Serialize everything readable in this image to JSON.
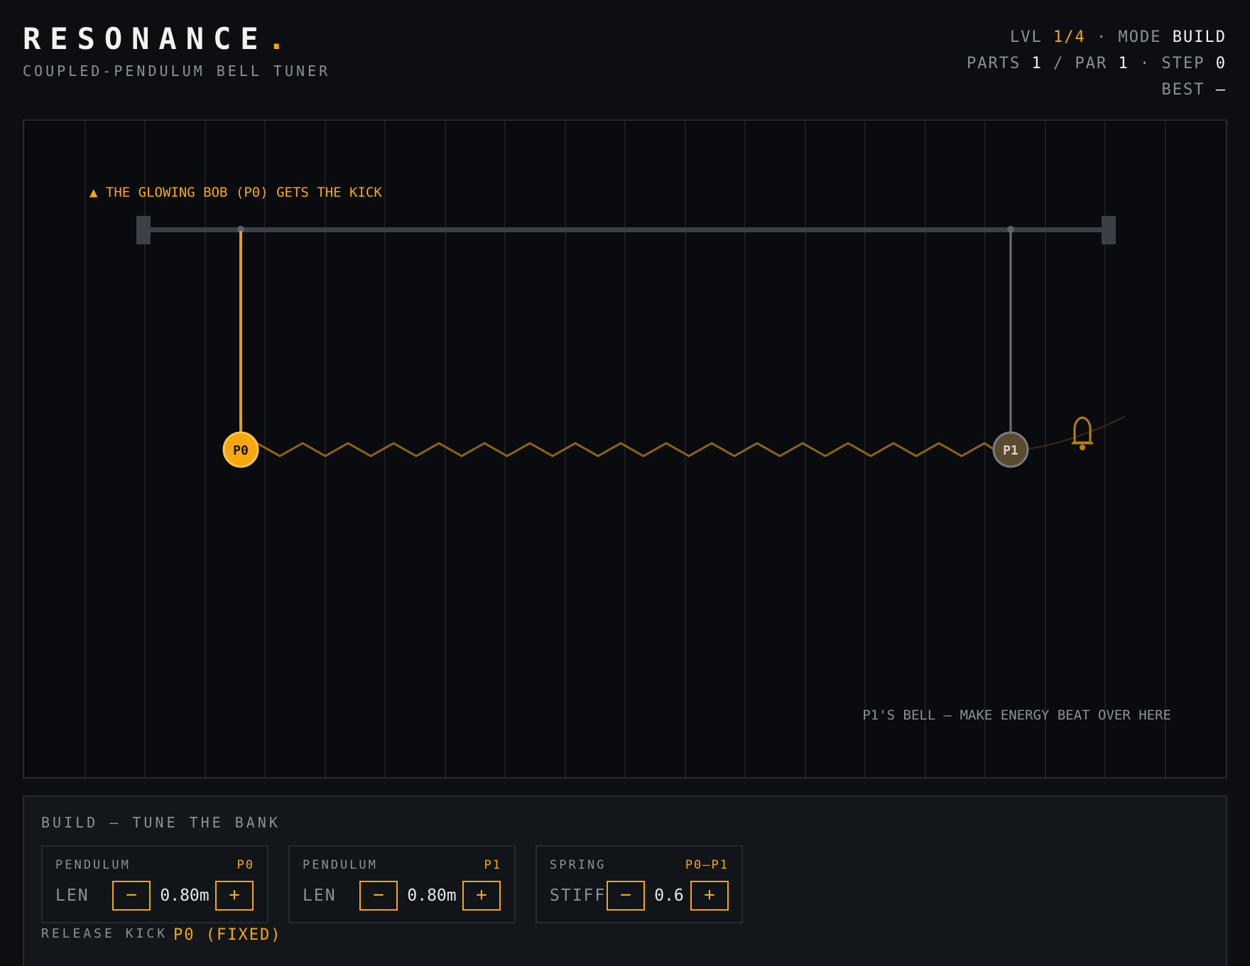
{
  "header": {
    "title": "RESONANCE",
    "title_dot": ".",
    "subtitle": "COUPLED-PENDULUM BELL TUNER"
  },
  "hud": {
    "lvl_label": "LVL",
    "lvl_value": "1/4",
    "sep": "·",
    "mode_label": "MODE",
    "mode_value": "BUILD",
    "parts_label": "PARTS",
    "parts_value": "1",
    "slash": "/",
    "par_label": "PAR",
    "par_value": "1",
    "step_label": "STEP",
    "step_value": "0",
    "best_label": "BEST",
    "best_value": "—"
  },
  "stage": {
    "hint_top": "▲ THE GLOWING BOB (P0) GETS THE KICK",
    "hint_bottom": "P1'S BELL — MAKE ENERGY BEAT OVER HERE",
    "pendulums": [
      {
        "id": "P0",
        "label": "P0",
        "active": true
      },
      {
        "id": "P1",
        "label": "P1",
        "active": false
      }
    ],
    "bell_icon": "bell-icon"
  },
  "build": {
    "title": "BUILD — TUNE THE BANK",
    "cards": [
      {
        "kind": "PENDULUM",
        "target": "P0",
        "param": "LEN",
        "value": "0.80m",
        "minus": "−",
        "plus": "+"
      },
      {
        "kind": "PENDULUM",
        "target": "P1",
        "param": "LEN",
        "value": "0.80m",
        "minus": "−",
        "plus": "+"
      },
      {
        "kind": "SPRING",
        "target": "P0–P1",
        "param": "STIFF",
        "value": "0.6",
        "minus": "−",
        "plus": "+"
      }
    ],
    "release_label": "RELEASE KICK",
    "release_value": "P0 (FIXED)"
  },
  "colors": {
    "accent": "#f5a80f",
    "background": "#0c0e12",
    "inactive_bob": "#5a4a2e"
  }
}
